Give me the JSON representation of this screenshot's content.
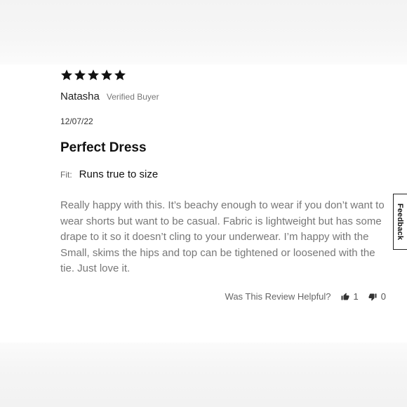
{
  "review": {
    "rating": 5,
    "rating_max": 5,
    "author": "Natasha",
    "badge": "Verified Buyer",
    "date": "12/07/22",
    "title": "Perfect Dress",
    "fit_label": "Fit:",
    "fit_value": "Runs true to size",
    "body": "Really happy with this. It’s beachy enough to wear if you don’t want to wear shorts but want to be casual. Fabric is lightweight but has some drape to it so it doesn’t cling to your underwear. I’m happy with the Small, skims the hips and top can be tightened or loosened with the tie. Just love it.",
    "helpful_label": "Was This Review Helpful?",
    "helpful_yes_count": "1",
    "helpful_no_count": "0"
  },
  "feedback_tab": {
    "label": "Feedback"
  },
  "icons": {
    "star": "star-icon",
    "thumbs_up": "thumbs-up-icon",
    "thumbs_down": "thumbs-down-icon"
  },
  "colors": {
    "star": "#111111",
    "body_text": "#777777",
    "background": "#ffffff"
  }
}
